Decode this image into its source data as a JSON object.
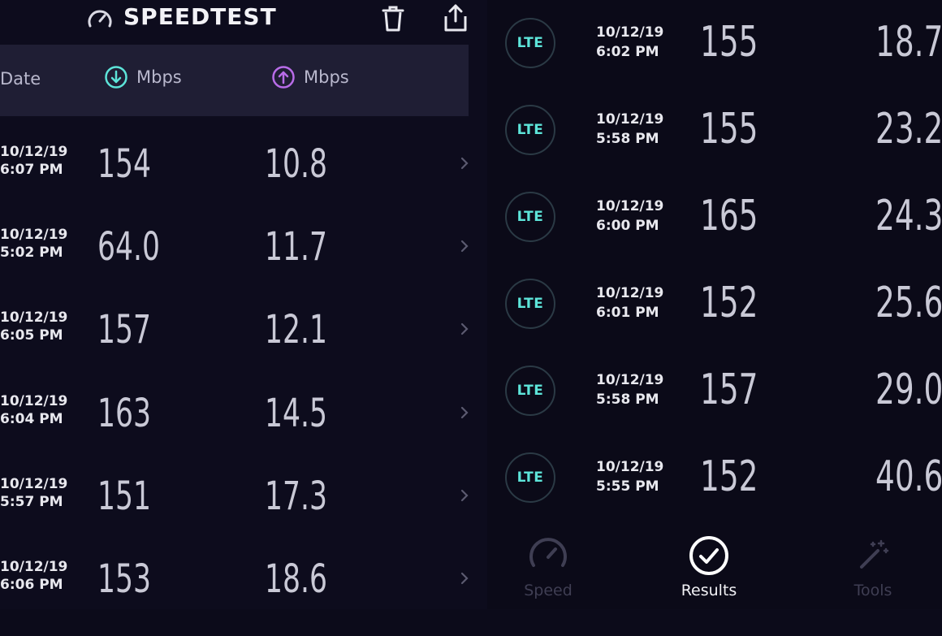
{
  "header": {
    "title": "SPEEDTEST",
    "icons": [
      "speedometer-logo-icon",
      "trash-icon",
      "share-icon"
    ]
  },
  "table_header": {
    "date_label": "Date",
    "download_label": "Mbps",
    "upload_label": "Mbps"
  },
  "history": [
    {
      "date": "10/12/19",
      "time": "6:07 PM",
      "download": "154",
      "upload": "10.8"
    },
    {
      "date": "10/12/19",
      "time": "5:02 PM",
      "download": "64.0",
      "upload": "11.7"
    },
    {
      "date": "10/12/19",
      "time": "6:05 PM",
      "download": "157",
      "upload": "12.1"
    },
    {
      "date": "10/12/19",
      "time": "6:04 PM",
      "download": "163",
      "upload": "14.5"
    },
    {
      "date": "10/12/19",
      "time": "5:57 PM",
      "download": "151",
      "upload": "17.3"
    },
    {
      "date": "10/12/19",
      "time": "6:06 PM",
      "download": "153",
      "upload": "18.6"
    }
  ],
  "results": [
    {
      "network": "LTE",
      "date": "10/12/19",
      "time": "6:02 PM",
      "download": "155",
      "upload": "18.7"
    },
    {
      "network": "LTE",
      "date": "10/12/19",
      "time": "5:58 PM",
      "download": "155",
      "upload": "23.2"
    },
    {
      "network": "LTE",
      "date": "10/12/19",
      "time": "6:00 PM",
      "download": "165",
      "upload": "24.3"
    },
    {
      "network": "LTE",
      "date": "10/12/19",
      "time": "6:01 PM",
      "download": "152",
      "upload": "25.6"
    },
    {
      "network": "LTE",
      "date": "10/12/19",
      "time": "5:58 PM",
      "download": "157",
      "upload": "29.0"
    },
    {
      "network": "LTE",
      "date": "10/12/19",
      "time": "5:55 PM",
      "download": "152",
      "upload": "40.6"
    }
  ],
  "tabs": [
    {
      "label": "Speed",
      "icon": "speedometer-icon",
      "active": false
    },
    {
      "label": "Results",
      "icon": "checkmark-circle-icon",
      "active": true
    },
    {
      "label": "Tools",
      "icon": "magic-wand-icon",
      "active": false
    }
  ],
  "colors": {
    "background": "#0c0b1a",
    "header_bar": "#1f1e34",
    "download_accent": "#5de4d9",
    "upload_accent": "#b86ce8",
    "lte_badge": "#5de4d9"
  }
}
